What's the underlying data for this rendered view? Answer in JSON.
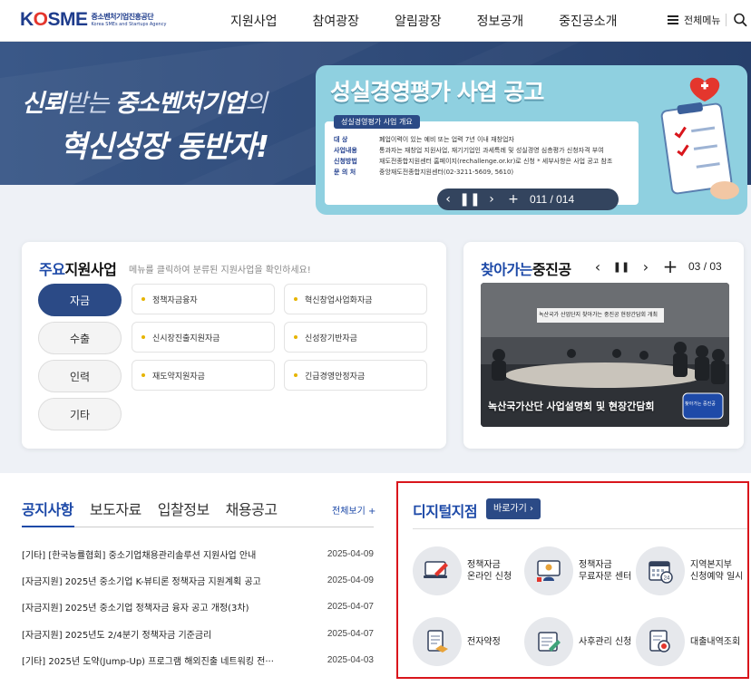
{
  "header": {
    "logo_text": "KOSME",
    "logo_sub_ko": "중소벤처기업진흥공단",
    "logo_sub_en": "Korea SMEs and Startups Agency",
    "nav": [
      "지원사업",
      "참여광장",
      "알림광장",
      "정보공개",
      "중진공소개"
    ],
    "all_menu_label": "전체메뉴"
  },
  "hero": {
    "slogan_line1_strong1": "신뢰",
    "slogan_line1_thin1": "받는 ",
    "slogan_line1_strong2": "중소벤처기업",
    "slogan_line1_thin2": "의",
    "slogan_line2": "혁신성장 동반자!"
  },
  "banner": {
    "title": "성실경영평가 사업 공고",
    "chip": "성실경영평가 사업 개요",
    "rows": [
      {
        "key": "대 상",
        "value": "폐업이력이 있는 예비 또는 업력 7년 이내 재창업자"
      },
      {
        "key": "사업내용",
        "value": "통과자는 재창업 지원사업, 재기기업인 과세특례 및 성실경영 심층평가 신청자격 부여"
      },
      {
        "key": "신청방법",
        "value": "재도전종합지원센터 홈페이지(rechallenge.or.kr)로 신청 * 세부사항은 사업 공고 참조"
      },
      {
        "key": "문 의 처",
        "value": "중앙재도전종합지원센터(02-3211-5609, 5610)"
      }
    ],
    "counter": "011 / 014"
  },
  "main_support": {
    "title_blue": "주요",
    "title_rest": "지원사업",
    "description": "메뉴를 클릭하여 분류된 지원사업을 확인하세요!",
    "categories": [
      "자금",
      "수출",
      "인력",
      "기타"
    ],
    "active_category": "자금",
    "programs": [
      "정책자금융자",
      "혁신창업사업화자금",
      "신시장진출지원자금",
      "신성장기반자금",
      "재도약지원자금",
      "긴급경영안정자금"
    ]
  },
  "visit": {
    "title_blue": "찾아가는",
    "title_rest": "중진공",
    "current": "03",
    "total": "03",
    "caption": "녹산국가산단 사업설명회 및 현장간담회",
    "photo_banner": "녹산국가 산업단지 찾아가는 중진공 현장간담회 개최",
    "photo_badge": "찾아가는 중진공"
  },
  "notices": {
    "tabs": [
      "공지사항",
      "보도자료",
      "입찰정보",
      "채용공고"
    ],
    "active_tab": "공지사항",
    "more_label": "전체보기 +",
    "items": [
      {
        "title": "[기타] [한국능률협회] 중소기업채용관리솔루션 지원사업 안내",
        "date": "2025-04-09"
      },
      {
        "title": "[자금지원] 2025년 중소기업 K-뷰티론 정책자금 지원계획 공고",
        "date": "2025-04-09"
      },
      {
        "title": "[자금지원] 2025년 중소기업 정책자금 융자 공고 개정(3차)",
        "date": "2025-04-07"
      },
      {
        "title": "[자금지원] 2025년도 2/4분기 정책자금 기준금리",
        "date": "2025-04-07"
      },
      {
        "title": "[기타] 2025년 도약(Jump-Up) 프로그램 해외진출 네트워킹 전···",
        "date": "2025-04-03"
      }
    ]
  },
  "digital": {
    "title": "디지털지점",
    "go_label": "바로가기 ›",
    "services": [
      {
        "line1": "정책자금",
        "line2": "온라인 신청",
        "icon": "online-application-icon"
      },
      {
        "line1": "정책자금",
        "line2": "무료자문 센터",
        "icon": "consulting-center-icon"
      },
      {
        "line1": "지역본지부",
        "line2": "신청예약 일시",
        "icon": "calendar-reservation-icon"
      },
      {
        "line1": "전자약정",
        "line2": "",
        "icon": "e-contract-icon"
      },
      {
        "line1": "사후관리 신청",
        "line2": "",
        "icon": "aftercare-icon"
      },
      {
        "line1": "대출내역조회",
        "line2": "",
        "icon": "loan-history-icon"
      }
    ]
  },
  "colors": {
    "brand_navy": "#2b4a86",
    "accent_blue": "#1e4aa8",
    "highlight_red": "#d9161c",
    "hero_bg": "#2e4a78"
  }
}
